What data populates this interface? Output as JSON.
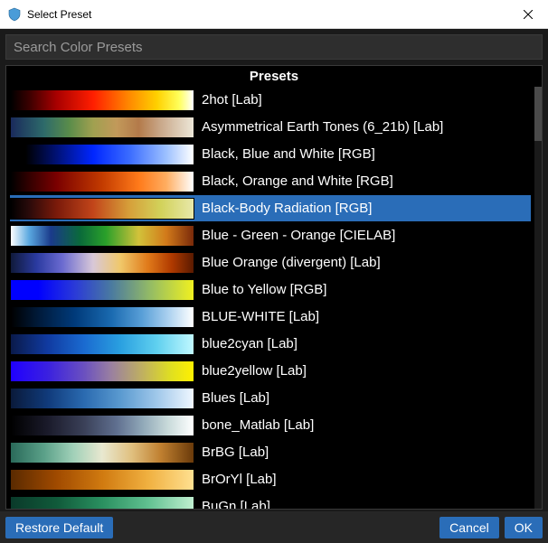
{
  "window": {
    "title": "Select Preset"
  },
  "search": {
    "placeholder": "Search Color Presets",
    "value": ""
  },
  "list_header": "Presets",
  "selected_index": 4,
  "presets": [
    {
      "label": "2hot [Lab]",
      "gradient": "linear-gradient(90deg,#000 0%,#3a0000 10%,#a80000 25%,#ff1e00 45%,#ff8a00 65%,#ffd000 80%,#ffff5a 92%,#ffffff 100%)"
    },
    {
      "label": "Asymmetrical Earth Tones (6_21b) [Lab]",
      "gradient": "linear-gradient(90deg,#1a2a5c 0%,#2d6a6a 18%,#5a8c4a 32%,#a0a050 45%,#c2995a 58%,#b37a4a 70%,#c9a88a 82%,#ece7d8 100%)"
    },
    {
      "label": "Black, Blue and White [RGB]",
      "gradient": "linear-gradient(90deg,#000 0%,#000 8%,#0026ff 45%,#3b6cff 65%,#9cc0ff 85%,#ffffff 100%)"
    },
    {
      "label": "Black, Orange and White [RGB]",
      "gradient": "linear-gradient(90deg,#000 0%,#320000 10%,#7a0000 25%,#c33b00 50%,#ff7a1a 70%,#ffad60 85%,#ffffff 100%)"
    },
    {
      "label": "Black-Body Radiation [RGB]",
      "gradient": "linear-gradient(90deg,#000 0%,#2a0a0a 10%,#7a1a0a 25%,#c2451a 45%,#d6a03a 65%,#d2d25a 82%,#e8e8aa 100%)"
    },
    {
      "label": "Blue - Green - Orange [CIELAB]",
      "gradient": "linear-gradient(90deg,#ffffff 0%,#5aa8e0 10%,#1a3a8a 22%,#0a6a3a 38%,#2aa02a 52%,#d2c23a 70%,#d27a1a 85%,#7a2a0a 100%)"
    },
    {
      "label": "Blue Orange (divergent) [Lab]",
      "gradient": "linear-gradient(90deg,#101a3a 0%,#2a3aa0 14%,#6a6ad0 28%,#d8c8d8 45%,#f0c86a 60%,#e07a1a 75%,#b03a00 88%,#5a1a00 100%)"
    },
    {
      "label": "Blue to Yellow [RGB]",
      "gradient": "linear-gradient(90deg,#0000ff 0%,#0000ff 15%,#2a3ad8 35%,#4a7aa0 55%,#9ac060 78%,#f0f020 100%)"
    },
    {
      "label": "BLUE-WHITE [Lab]",
      "gradient": "linear-gradient(90deg,#000 0%,#001a3a 15%,#003a7a 35%,#1a6ab0 55%,#5aa0d8 72%,#aad0ef 86%,#ffffff 100%)"
    },
    {
      "label": "blue2cyan [Lab]",
      "gradient": "linear-gradient(90deg,#0a1a4a 0%,#103aa0 20%,#1a6ad0 40%,#2aa0e0 60%,#60d0ef 80%,#c0f8ff 100%)"
    },
    {
      "label": "blue2yellow [Lab]",
      "gradient": "linear-gradient(90deg,#2000ff 0%,#3a20e0 20%,#6a50c0 40%,#9a80a0 55%,#c0b060 72%,#e0e020 88%,#fff000 100%)"
    },
    {
      "label": "Blues [Lab]",
      "gradient": "linear-gradient(90deg,#0a1a3a 0%,#103a7a 20%,#2a6ab0 40%,#5a9ad0 60%,#a0c8ea 80%,#f0f7ff 100%)"
    },
    {
      "label": "bone_Matlab [Lab]",
      "gradient": "linear-gradient(90deg,#000 0%,#1a1a2a 20%,#3a4058 40%,#607090 58%,#90a8b8 72%,#c8dada 86%,#ffffff 100%)"
    },
    {
      "label": "BrBG [Lab]",
      "gradient": "linear-gradient(90deg,#2a6a5a 0%,#5aa088 18%,#a0d0b8 34%,#e8e8d0 50%,#e0c080 66%,#c08030 82%,#6a3a0a 100%)"
    },
    {
      "label": "BrOrYl [Lab]",
      "gradient": "linear-gradient(90deg,#5a2a00 0%,#a04a00 25%,#d07a10 50%,#f0b040 75%,#ffe090 100%)"
    },
    {
      "label": "BuGn [Lab]",
      "gradient": "linear-gradient(90deg,#0a3a2a 0%,#105a3a 25%,#2a9060 50%,#60c090 75%,#c0efd0 100%)"
    }
  ],
  "footer": {
    "restore": "Restore Default",
    "cancel": "Cancel",
    "ok": "OK"
  }
}
